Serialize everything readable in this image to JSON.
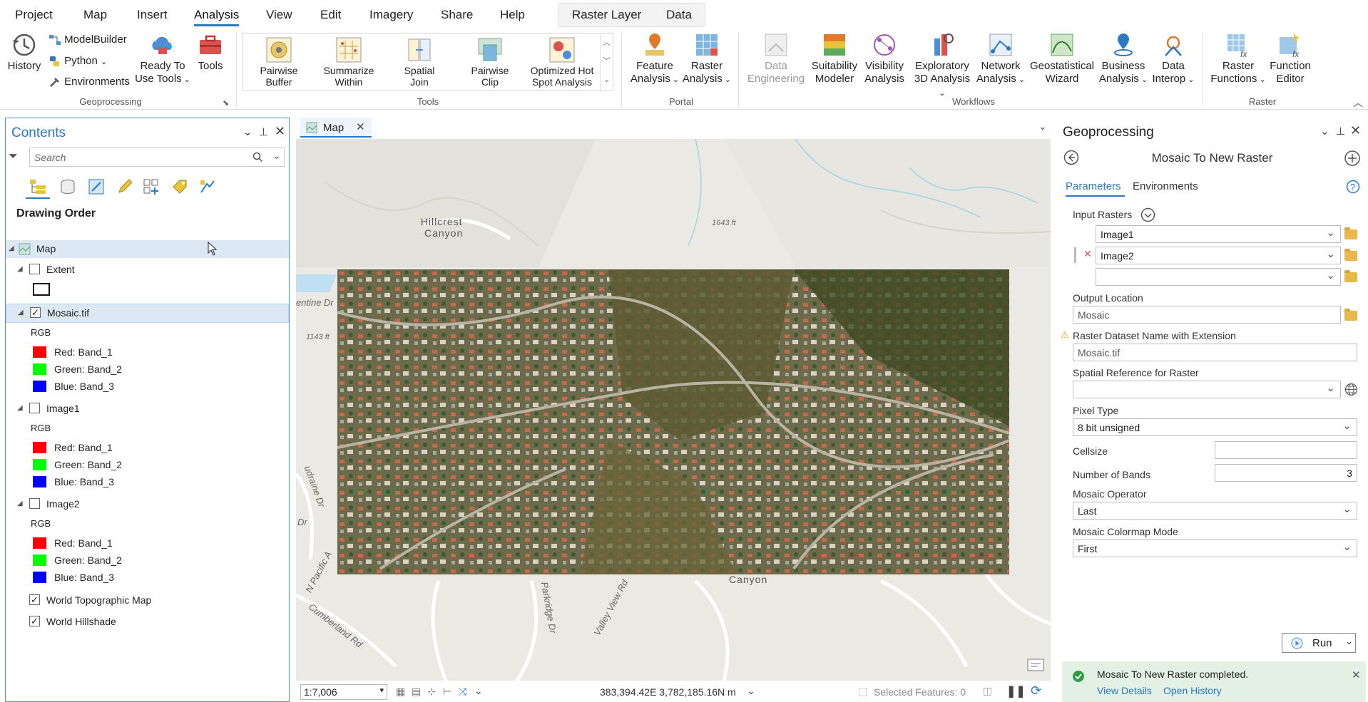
{
  "menu": {
    "tabs": [
      "Project",
      "Map",
      "Insert",
      "Analysis",
      "View",
      "Edit",
      "Imagery",
      "Share",
      "Help"
    ],
    "active": "Analysis",
    "context_tabs": [
      "Raster Layer",
      "Data"
    ]
  },
  "ribbon": {
    "geoprocessing": {
      "history": "History",
      "modelbuilder": "ModelBuilder",
      "python": "Python",
      "environments": "Environments",
      "ready_to_use_1": "Ready To",
      "ready_to_use_2": "Use Tools",
      "tools": "Tools",
      "label": "Geoprocessing"
    },
    "tools": {
      "items": [
        {
          "l1": "Pairwise",
          "l2": "Buffer"
        },
        {
          "l1": "Summarize",
          "l2": "Within"
        },
        {
          "l1": "Spatial",
          "l2": "Join"
        },
        {
          "l1": "Pairwise",
          "l2": "Clip"
        },
        {
          "l1": "Optimized Hot",
          "l2": "Spot Analysis"
        }
      ],
      "label": "Tools"
    },
    "portal": {
      "feature_1": "Feature",
      "feature_2": "Analysis",
      "raster_1": "Raster",
      "raster_2": "Analysis",
      "label": "Portal"
    },
    "workflows": {
      "items": [
        {
          "l1": "Data",
          "l2": "Engineering"
        },
        {
          "l1": "Suitability",
          "l2": "Modeler"
        },
        {
          "l1": "Visibility",
          "l2": "Analysis"
        },
        {
          "l1": "Exploratory",
          "l2": "3D Analysis"
        },
        {
          "l1": "Network",
          "l2": "Analysis"
        },
        {
          "l1": "Geostatistical",
          "l2": "Wizard"
        },
        {
          "l1": "Business",
          "l2": "Analysis"
        },
        {
          "l1": "Data",
          "l2": "Interop"
        }
      ],
      "label": "Workflows"
    },
    "raster": {
      "rf_1": "Raster",
      "rf_2": "Functions",
      "fe_1": "Function",
      "fe_2": "Editor",
      "label": "Raster"
    }
  },
  "contents": {
    "title": "Contents",
    "search_placeholder": "Search",
    "drawing_order": "Drawing Order",
    "map": "Map",
    "extent": "Extent",
    "mosaic": "Mosaic.tif",
    "image1": "Image1",
    "image2": "Image2",
    "rgb": "RGB",
    "red": "Red:   Band_1",
    "green": "Green: Band_2",
    "blue": "Blue:  Band_3",
    "topo": "World Topographic Map",
    "hillshade": "World Hillshade",
    "colors": {
      "red": "#ff0000",
      "green": "#00ff00",
      "blue": "#0000ff"
    }
  },
  "mapview": {
    "tab": "Map",
    "labels": {
      "hillcrest1": "Hillcrest",
      "hillcrest2": "Canyon",
      "elev1": "1643 ft",
      "elev2": "1143 ft",
      "entine": "entine Dr",
      "udraine": "udraine Dr",
      "dr": "Dr",
      "pacific": "N Pacific A",
      "cumberland": "Cumberland Rd",
      "parkridge": "Parkridge Dr",
      "valley": "Valley View Rd",
      "canyon": "Canyon"
    },
    "scale": "1:7,006",
    "coords": "383,394.42E 3,782,185.16N m",
    "selected": "Selected Features: 0"
  },
  "geoprocessing": {
    "title": "Geoprocessing",
    "tool": "Mosaic To New Raster",
    "tab_params": "Parameters",
    "tab_env": "Environments",
    "input_rasters": "Input Rasters",
    "raster1": "Image1",
    "raster2": "Image2",
    "output_location_label": "Output Location",
    "output_location": "Mosaic",
    "dataset_label": "Raster Dataset Name with Extension",
    "dataset": "Mosaic.tif",
    "spatial_ref_label": "Spatial Reference for  Raster",
    "pixel_type_label": "Pixel Type",
    "pixel_type": "8 bit unsigned",
    "cellsize_label": "Cellsize",
    "bands_label": "Number of Bands",
    "bands": "3",
    "operator_label": "Mosaic Operator",
    "operator": "Last",
    "colormap_label": "Mosaic Colormap Mode",
    "colormap": "First",
    "run": "Run",
    "toast": "Mosaic To New Raster completed.",
    "view_details": "View Details",
    "open_history": "Open History"
  }
}
